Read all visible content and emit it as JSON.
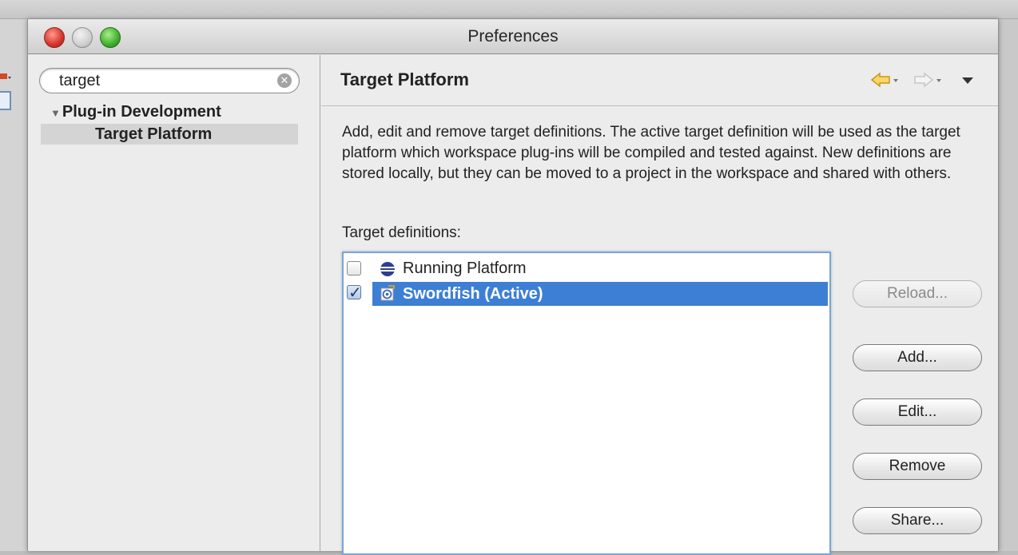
{
  "window": {
    "title": "Preferences"
  },
  "search": {
    "value": "target"
  },
  "tree": {
    "group": "Plug-in Development",
    "selected_item": "Target Platform"
  },
  "page": {
    "title": "Target Platform",
    "description": "Add, edit and remove target definitions.  The active target definition will be used as the target platform which workspace plug-ins will be compiled and tested against.  New definitions are stored locally, but they can be moved to a project in the workspace and shared with others.",
    "definitions_label": "Target definitions:"
  },
  "definitions": [
    {
      "label": "Running Platform",
      "checked": false,
      "icon": "eclipse-icon"
    },
    {
      "label": "Swordfish (Active)",
      "checked": true,
      "selected": true,
      "icon": "target-icon"
    }
  ],
  "buttons": {
    "reload": "Reload...",
    "add": "Add...",
    "edit": "Edit...",
    "remove": "Remove",
    "share": "Share..."
  },
  "colors": {
    "selection": "#3d7fd4",
    "nav_arrow": "#f0b830"
  }
}
